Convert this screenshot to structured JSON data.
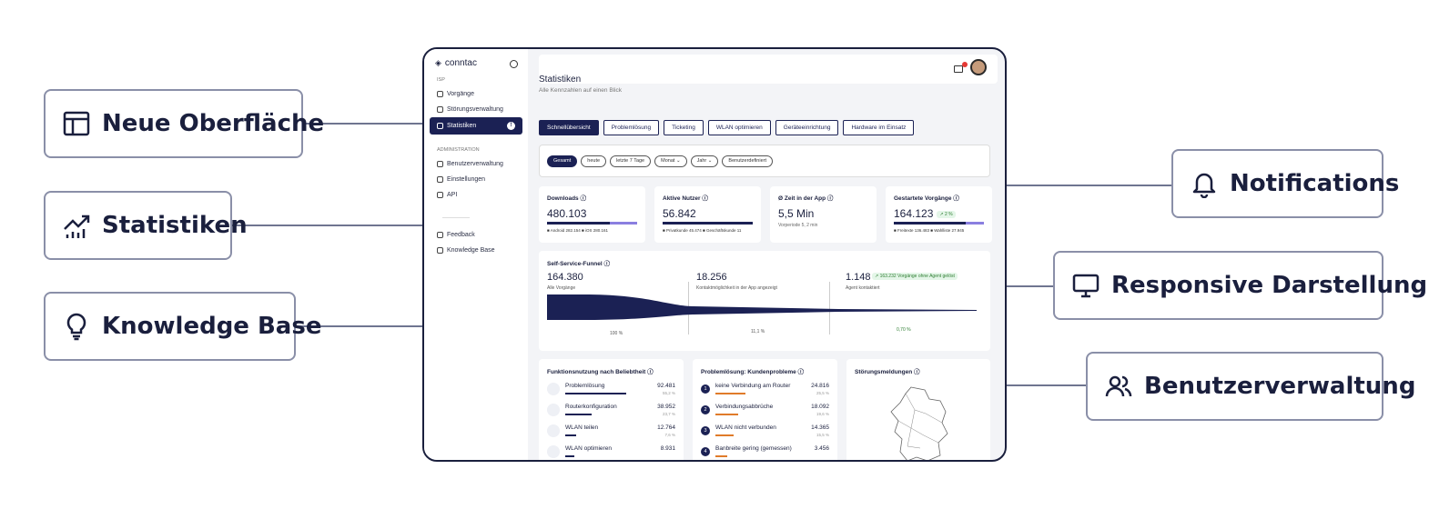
{
  "callouts": {
    "left": [
      "Neue Oberfläche",
      "Statistiken",
      "Knowledge Base"
    ],
    "right": [
      "Notifications",
      "Responsive Darstellung",
      "Benutzerverwaltung"
    ]
  },
  "app": {
    "logo": "conntac",
    "sidebar": {
      "section1": "ISP",
      "items1": [
        "Vorgänge",
        "Störungsverwaltung",
        "Statistiken"
      ],
      "active_badge": "!",
      "section2": "ADMINISTRATION",
      "items2": [
        "Benutzerverwaltung",
        "Einstellungen",
        "API"
      ],
      "items3": [
        "Feedback",
        "Knowledge Base"
      ]
    },
    "page_title": "Statistiken",
    "page_subtitle": "Alle Kennzahlen auf einen Blick",
    "tabs": [
      "Schnellübersicht",
      "Problemlösung",
      "Ticketing",
      "WLAN optimieren",
      "Geräteeinrichtung",
      "Hardware im Einsatz"
    ],
    "filters": [
      "Gesamt",
      "heute",
      "letzte 7 Tage",
      "Monat ⌄",
      "Jahr ⌄",
      "Benutzerdefiniert"
    ],
    "kpis": [
      {
        "label": "Downloads ⓘ",
        "value": "480.103",
        "legend": "■ Android 282.154    ■ iOS 280.161",
        "fraction": 0.7
      },
      {
        "label": "Aktive Nutzer ⓘ",
        "value": "56.842",
        "legend": "■ Privatkunde 45.474  ■ Geschäftskunde 11",
        "fraction": 1.0
      },
      {
        "label": "Ø Zeit in der App ⓘ",
        "value": "5,5 Min",
        "sub": "Vorperiode 5, 2 min"
      },
      {
        "label": "Gestartete Vorgänge ⓘ",
        "value": "164.123",
        "delta": "↗ 2 %",
        "legend": "■ Freitexte 136.483  ■ Wahlliste 27.945",
        "fraction": 0.8
      }
    ],
    "funnel": {
      "title": "Self-Service-Funnel ⓘ",
      "steps": [
        {
          "value": "164.380",
          "desc": "Alle Vorgänge",
          "pct": "100 %"
        },
        {
          "value": "18.256",
          "desc": "Kontaktmöglichkeit in der App angezeigt",
          "pct": "11,1 %"
        },
        {
          "value": "1.148",
          "desc": "Agent kontaktiert",
          "pct": "0,70 %",
          "badge": "↗ 163.232 Vorgänge ohne Agent gelöst"
        }
      ]
    },
    "usage": {
      "title": "Funktionsnutzung nach Beliebtheit ⓘ",
      "rows": [
        {
          "label": "Problemlösung",
          "value": "92.481",
          "pct": "55,2 %"
        },
        {
          "label": "Routerkonfiguration",
          "value": "38.952",
          "pct": "23,7 %"
        },
        {
          "label": "WLAN teilen",
          "value": "12.764",
          "pct": "7,6 %"
        },
        {
          "label": "WLAN optimieren",
          "value": "8.931",
          "pct": ""
        }
      ]
    },
    "problems": {
      "title": "Problemlösung: Kundenprobleme ⓘ",
      "rows": [
        {
          "n": "1",
          "label": "keine Verbindung am Router",
          "value": "24.816",
          "pct": "25,5 %"
        },
        {
          "n": "2",
          "label": "Verbindungsabbrüche",
          "value": "18.092",
          "pct": "19,6 %"
        },
        {
          "n": "3",
          "label": "WLAN nicht verbunden",
          "value": "14.365",
          "pct": "15,5 %"
        },
        {
          "n": "4",
          "label": "Banbreite gering (gemessen)",
          "value": "3.456",
          "pct": ""
        }
      ]
    },
    "outages": {
      "title": "Störungsmeldungen ⓘ"
    }
  }
}
